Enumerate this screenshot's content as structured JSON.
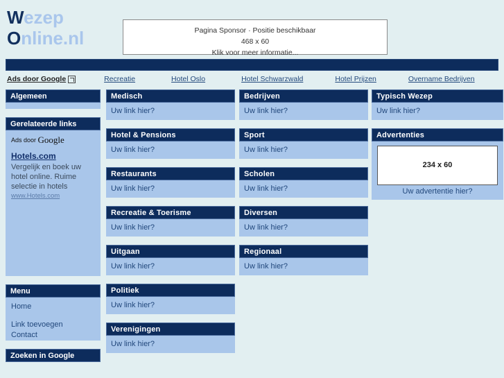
{
  "site": {
    "logo_line1_cap": "W",
    "logo_line1_rest": "ezep",
    "logo_line2_cap": "O",
    "logo_line2_rest": "nline.nl"
  },
  "sponsor": {
    "line1": "Pagina Sponsor · Positie beschikbaar",
    "line2": "468 x 60",
    "line3": "Klik voor meer informatie..."
  },
  "ads_strip": {
    "label": "Ads door Google",
    "links": [
      "Recreatie",
      "Hotel Oslo",
      "Hotel Schwarzwald",
      "Hotel Prijzen",
      "Overname Bedrijven"
    ]
  },
  "sidebar": {
    "algemeen": {
      "title": "Algemeen"
    },
    "related": {
      "title": "Gerelateerde links",
      "ads_by_prefix": "Ads door ",
      "ads_by_brand": "Google",
      "ad_title": "Hotels.com",
      "ad_desc": "Vergelijk en boek uw hotel online. Ruime selectie in hotels",
      "ad_url": "www.Hotels.com"
    },
    "menu": {
      "title": "Menu",
      "items": [
        "Home",
        "Link toevoegen",
        "Contact"
      ]
    },
    "search": {
      "title": "Zoeken in Google"
    }
  },
  "link_text": "Uw link hier?",
  "columns": {
    "col1": [
      {
        "title": "Medisch"
      },
      {
        "title": "Hotel & Pensions"
      },
      {
        "title": "Restaurants"
      },
      {
        "title": "Recreatie & Toerisme"
      },
      {
        "title": "Uitgaan"
      },
      {
        "title": "Politiek"
      },
      {
        "title": "Verenigingen"
      }
    ],
    "col2": [
      {
        "title": "Bedrijven"
      },
      {
        "title": "Sport"
      },
      {
        "title": "Scholen"
      },
      {
        "title": "Diversen"
      },
      {
        "title": "Regionaal"
      }
    ],
    "col3": [
      {
        "title": "Typisch Wezep"
      }
    ]
  },
  "advert": {
    "title": "Advertenties",
    "box_label": "234 x 60",
    "caption": "Uw advertentie hier?"
  },
  "colors": {
    "page_bg": "#e2eff1",
    "navy": "#0d2c5c",
    "panel_body": "#a9c6ea",
    "logo_light": "#a9c6ec",
    "logo_dark": "#12305e"
  }
}
